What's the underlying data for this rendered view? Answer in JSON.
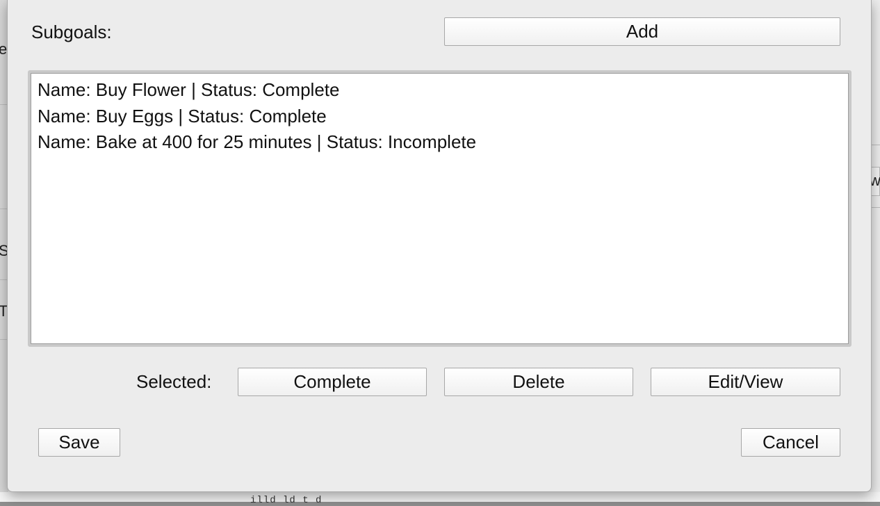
{
  "background": {
    "fragments": [
      "e",
      "S",
      "T",
      "w"
    ],
    "bottom_text": "illd ld t d"
  },
  "dialog": {
    "subgoals_label": "Subgoals:",
    "add_label": "Add",
    "subgoals": [
      {
        "text": "Name: Buy Flower | Status: Complete"
      },
      {
        "text": "Name: Buy Eggs | Status: Complete"
      },
      {
        "text": "Name: Bake at 400 for 25 minutes | Status: Incomplete"
      }
    ],
    "selected_label": "Selected:",
    "complete_label": "Complete",
    "delete_label": "Delete",
    "edit_view_label": "Edit/View",
    "save_label": "Save",
    "cancel_label": "Cancel"
  }
}
